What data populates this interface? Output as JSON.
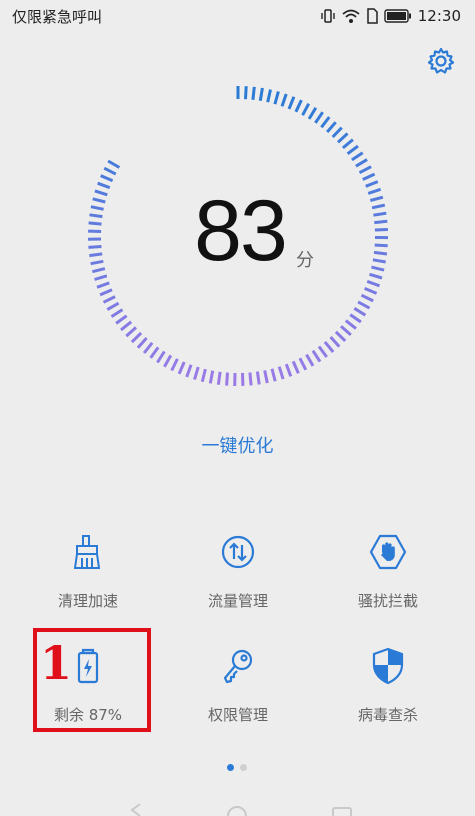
{
  "status_bar": {
    "carrier": "仅限紧急呼叫",
    "time": "12:30",
    "icons": [
      "vibrate-icon",
      "wifi-icon",
      "sim-icon",
      "battery-icon"
    ]
  },
  "header": {
    "settings_icon": "gear-icon"
  },
  "dial": {
    "score": "83",
    "unit": "分",
    "accent": "#2b7bd6",
    "accent_end": "#9a7be6"
  },
  "optimize_label": "一键优化",
  "tools": [
    {
      "label": "清理加速",
      "icon": "broom-icon"
    },
    {
      "label": "流量管理",
      "icon": "data-traffic-icon"
    },
    {
      "label": "骚扰拦截",
      "icon": "block-hand-icon"
    },
    {
      "label": "剩余 87%",
      "icon": "battery-charge-icon"
    },
    {
      "label": "权限管理",
      "icon": "key-icon"
    },
    {
      "label": "病毒查杀",
      "icon": "shield-icon"
    }
  ],
  "annotation": {
    "number": "1",
    "color": "#e0101a"
  },
  "pager": {
    "pages": 2,
    "active": 0
  }
}
